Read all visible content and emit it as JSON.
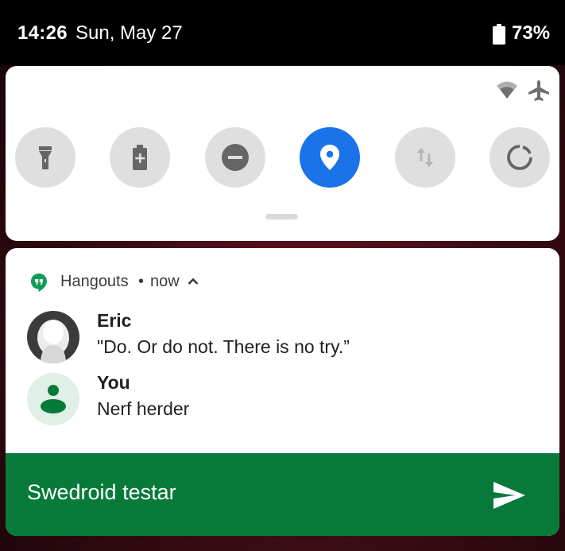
{
  "status_bar": {
    "time": "14:26",
    "date": "Sun, May 27",
    "battery_percent": "73%",
    "icons": [
      "battery-icon"
    ]
  },
  "quick_settings": {
    "top_icons": [
      "wifi-icon",
      "airplane-mode-icon"
    ],
    "tiles": [
      {
        "icon": "flashlight-icon",
        "active": false
      },
      {
        "icon": "battery-saver-icon",
        "active": false
      },
      {
        "icon": "do-not-disturb-icon",
        "active": false
      },
      {
        "icon": "location-icon",
        "active": true
      },
      {
        "icon": "mobile-data-icon",
        "active": false
      },
      {
        "icon": "auto-rotate-icon",
        "active": false
      }
    ],
    "colors": {
      "active": "#1a73e8",
      "inactive": "#dfdfdf"
    }
  },
  "notification": {
    "app_name": "Hangouts",
    "separator": "•",
    "time": "now",
    "app_icon": "hangouts-icon",
    "messages": [
      {
        "sender": "Eric",
        "text": "\"Do. Or do not. There is no try.”",
        "avatar": "person-photo-avatar"
      },
      {
        "sender": "You",
        "text": "Nerf herder",
        "avatar": "person-icon"
      }
    ],
    "reply": {
      "text": "Swedroid testar",
      "send_icon": "send-icon"
    },
    "colors": {
      "brand": "#0f9d58",
      "reply_bar": "#077a3a"
    }
  }
}
